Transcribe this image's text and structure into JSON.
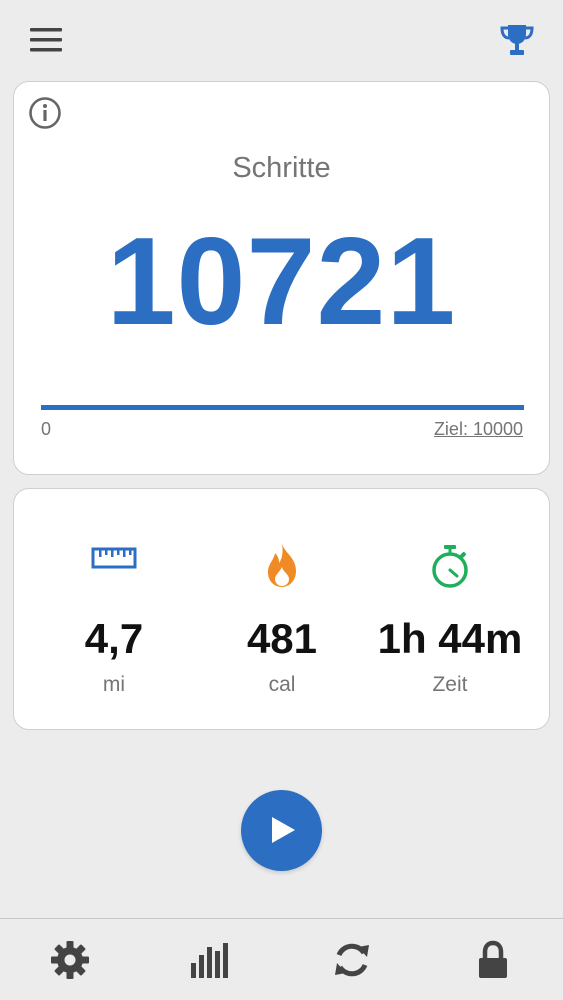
{
  "steps": {
    "label": "Schritte",
    "value": "10721",
    "progress_min": "0",
    "goal_label": "Ziel: 10000",
    "progress_fraction": 1.0
  },
  "stats": [
    {
      "icon": "ruler-icon",
      "value": "4,7",
      "unit": "mi"
    },
    {
      "icon": "flame-icon",
      "value": "481",
      "unit": "cal"
    },
    {
      "icon": "stopwatch-icon",
      "value": "1h 44m",
      "unit": "Zeit"
    }
  ],
  "colors": {
    "accent": "#2b6ec2",
    "flame": "#f08a24",
    "stopwatch": "#1fae5b",
    "background": "#ececec",
    "icon_gray": "#444444"
  },
  "icons": {
    "top_left": "menu-icon",
    "top_right": "trophy-icon",
    "card": "info-icon",
    "play": "play-icon",
    "nav": [
      "gear-icon",
      "bar-chart-icon",
      "refresh-icon",
      "lock-icon"
    ]
  }
}
